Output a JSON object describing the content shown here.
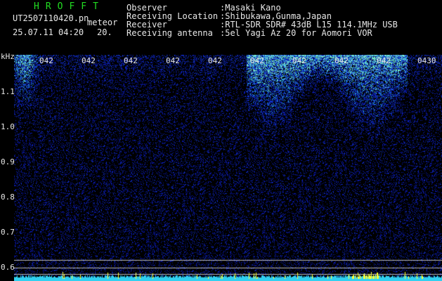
{
  "header": {
    "brand": "HROFFT",
    "filename": "UT2507110420.pn",
    "mode": "meteor",
    "datetime": "25.07.11 04:20",
    "dwell": "20."
  },
  "info": [
    {
      "label": "Observer",
      "value": ":Masaki Kano"
    },
    {
      "label": "Receiving Location",
      "value": ":Shibukawa,Gunma,Japan"
    },
    {
      "label": "Receiver",
      "value": ":RTL-SDR SDR# 43dB L15 114.1MHz USB"
    },
    {
      "label": "Receiving antenna",
      "value": ":5el Yagi Az 20 for Aomori VOR"
    }
  ],
  "y_axis": {
    "unit": "kHz",
    "labels": [
      "1.1",
      "1.0",
      "0.9",
      "0.8",
      "0.7",
      "0.6"
    ]
  },
  "time_ticks": [
    "042",
    "042",
    "042",
    "042",
    "042",
    "042",
    "042",
    "042",
    "042",
    "0430"
  ],
  "colors": {
    "background": "#000000",
    "header_green": "#22dd22",
    "text_white": "#e8e8e8",
    "noise_blue": "#1a2fd0",
    "echo_cyan": "#39d6c8",
    "echo_yellow": "#ffff33"
  }
}
